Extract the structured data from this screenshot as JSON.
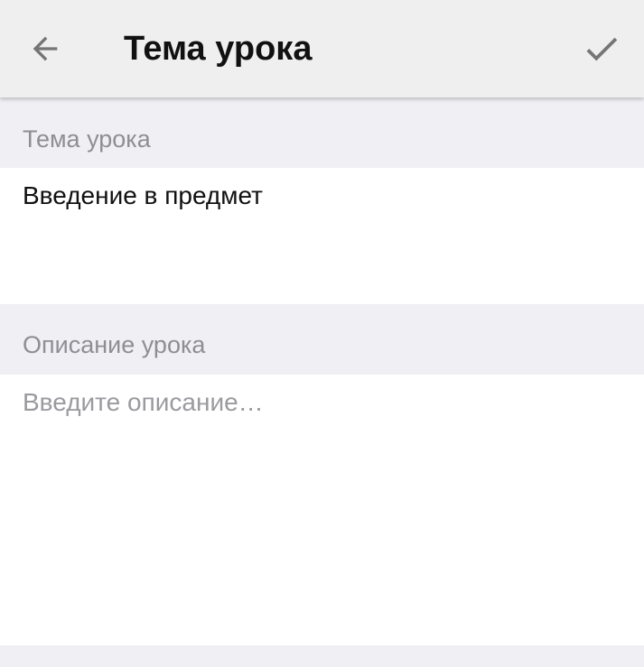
{
  "toolbar": {
    "back_icon": "arrow-back-icon",
    "title": "Тема урока",
    "confirm_icon": "checkmark-icon"
  },
  "topic": {
    "label": "Тема урока",
    "value": "Введение в предмет"
  },
  "description": {
    "label": "Описание урока",
    "placeholder": "Введите описание…",
    "value": ""
  },
  "colors": {
    "toolbar_bg": "#efefef",
    "section_bg": "#efeff4",
    "field_bg": "#ffffff",
    "label_text": "#8e8e93",
    "placeholder_text": "#9a9a9f",
    "icon": "#757575"
  }
}
